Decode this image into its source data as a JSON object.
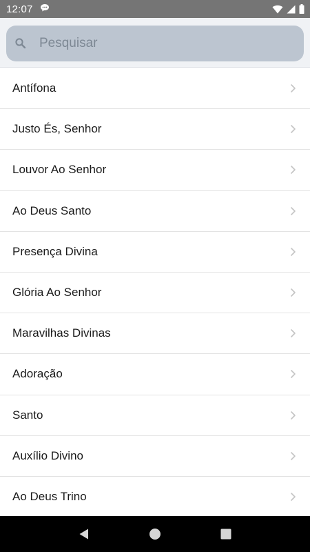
{
  "status_bar": {
    "time": "12:07",
    "icons": [
      "notification-icon",
      "wifi-icon",
      "signal-icon",
      "battery-icon"
    ]
  },
  "search": {
    "placeholder": "Pesquisar",
    "value": ""
  },
  "list": {
    "items": [
      {
        "label": "Antífona"
      },
      {
        "label": "Justo És, Senhor"
      },
      {
        "label": "Louvor Ao Senhor"
      },
      {
        "label": "Ao Deus Santo"
      },
      {
        "label": "Presença Divina"
      },
      {
        "label": "Glória Ao Senhor"
      },
      {
        "label": "Maravilhas Divinas"
      },
      {
        "label": "Adoração"
      },
      {
        "label": "Santo"
      },
      {
        "label": "Auxílio Divino"
      },
      {
        "label": "Ao Deus Trino"
      }
    ]
  },
  "nav_bar": {
    "buttons": [
      "back-icon",
      "home-icon",
      "recents-icon"
    ]
  }
}
